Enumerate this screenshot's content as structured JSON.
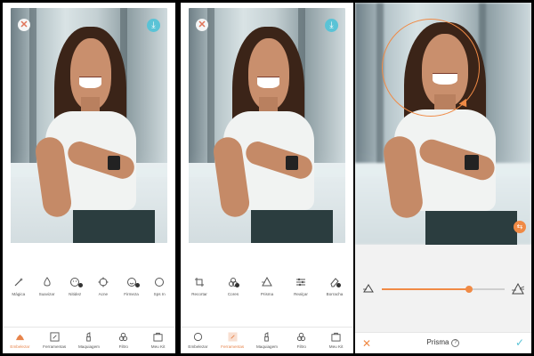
{
  "panel1": {
    "tools": [
      {
        "label": "Mágica",
        "icon": "magic-wand-icon"
      },
      {
        "label": "Suavizar",
        "icon": "droplet-icon"
      },
      {
        "label": "Nitidez",
        "icon": "face-icon"
      },
      {
        "label": "Acne",
        "icon": "crosshair-icon"
      },
      {
        "label": "Firmeza",
        "icon": "face-smile-icon"
      },
      {
        "label": "Sps In",
        "icon": "circle-icon"
      }
    ],
    "nav": [
      {
        "label": "Embelezar",
        "active": true
      },
      {
        "label": "Ferramentas",
        "active": false
      },
      {
        "label": "Maquiagem",
        "active": false
      },
      {
        "label": "Filtro",
        "active": false
      },
      {
        "label": "Meu Kit",
        "active": false
      }
    ]
  },
  "panel2": {
    "tools": [
      {
        "label": "Recortar",
        "icon": "crop-icon"
      },
      {
        "label": "Cores",
        "icon": "palette-icon"
      },
      {
        "label": "Prisma",
        "icon": "prism-icon"
      },
      {
        "label": "Realçar",
        "icon": "sliders-icon"
      },
      {
        "label": "Borracha",
        "icon": "eraser-icon"
      }
    ],
    "nav": [
      {
        "label": "Embelezar",
        "active": false
      },
      {
        "label": "Ferramentas",
        "active": true
      },
      {
        "label": "Maquiagem",
        "active": false
      },
      {
        "label": "Filtro",
        "active": false
      },
      {
        "label": "Meu Kit",
        "active": false
      }
    ]
  },
  "panel3": {
    "title": "Prisma",
    "slider_value": 0.71,
    "colors": {
      "accent": "#f08a45",
      "confirm": "#5ac3d6"
    }
  }
}
